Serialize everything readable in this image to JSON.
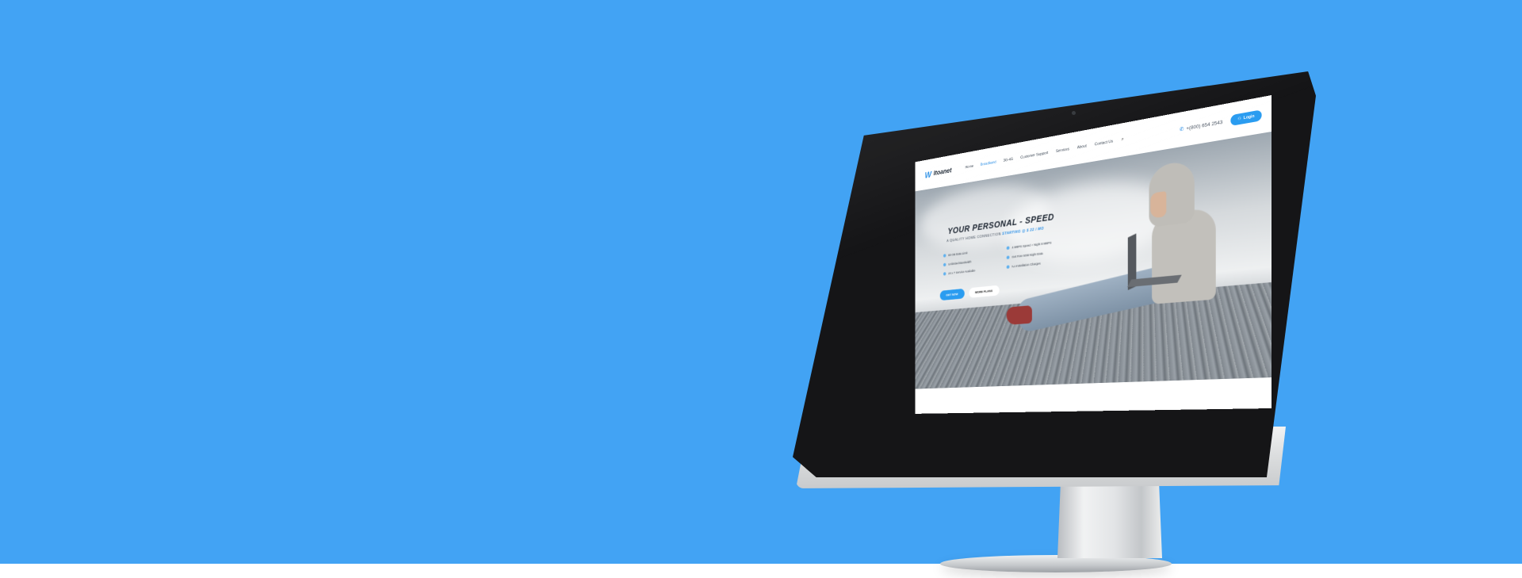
{
  "colors": {
    "background": "#42a3f4",
    "accent": "#2a9cf0",
    "bezel": "#151517"
  },
  "site": {
    "logo_text": "Itoanet",
    "nav_items": [
      "Home",
      "Broadband",
      "3G-4G",
      "Customer Support",
      "Services",
      "About",
      "Contact Us"
    ],
    "active_nav": "Broadband",
    "phone": "+(800) 654 2543",
    "login_label": "Login",
    "hero": {
      "title": "YOUR PERSONAL - SPEED",
      "subtitle_prefix": "A QUALITY HOME CONNECTION",
      "subtitle_highlight": "STARTING @ $ 22 / MO",
      "features": [
        "80 GB Data Limit",
        "4 MBPS Speed + Night 8 MBPS",
        "Unlimited Bandwidth",
        "Get Free 5GB Night Data",
        "24 x 7 Service Available",
        "No Installation Charges"
      ],
      "cta_primary": "GET NOW",
      "cta_secondary": "MORE PLANS"
    }
  },
  "icons": {
    "logo_mark": "logo-w-icon",
    "search": "search-icon",
    "phone": "phone-icon",
    "user": "user-icon",
    "feature": "check-dot-icon",
    "brand": "star-logo-icon"
  }
}
